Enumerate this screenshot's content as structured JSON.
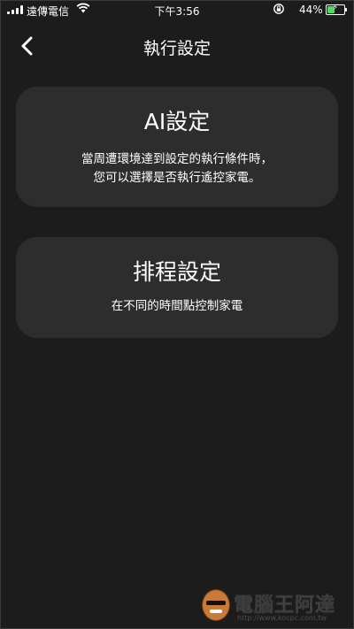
{
  "status_bar": {
    "carrier": "遠傳電信",
    "time": "下午3:56",
    "battery_percent": "44%",
    "battery_level": 0.44,
    "battery_charging": true,
    "accent_battery_color": "#4cd964"
  },
  "header": {
    "title": "執行設定",
    "back_icon": "chevron-left-icon"
  },
  "cards": [
    {
      "title": "AI設定",
      "description": "當周遭環境達到設定的執行條件時，\n您可以選擇是否執行遙控家電。"
    },
    {
      "title": "排程設定",
      "description": "在不同的時間點控制家電"
    }
  ],
  "watermark": {
    "text": "電腦王阿達",
    "url": "http://www.kocpc.com.tw"
  },
  "colors": {
    "background": "#1c1c1c",
    "card": "#2d2d2d",
    "text": "#ffffff"
  }
}
